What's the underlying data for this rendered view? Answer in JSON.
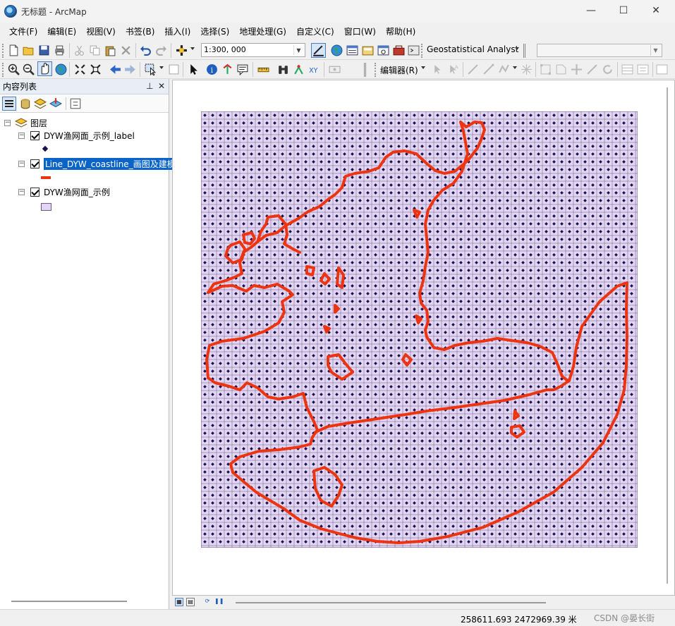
{
  "window": {
    "title": "无标题 - ArcMap",
    "minimize": "—",
    "maximize": "☐",
    "close": "✕"
  },
  "menu": [
    "文件(F)",
    "编辑(E)",
    "视图(V)",
    "书签(B)",
    "插入(I)",
    "选择(S)",
    "地理处理(G)",
    "自定义(C)",
    "窗口(W)",
    "帮助(H)"
  ],
  "toolbar": {
    "scale": "1:300, 000",
    "geostatistical": "Geostatistical Analyst",
    "editor": "编辑器(R)"
  },
  "toc": {
    "title": "内容列表",
    "pin": "ꟷ",
    "close": "✕",
    "root": "图层",
    "layers": [
      {
        "name": "DYW渔网面_示例_label",
        "symbol": "point",
        "checked": true
      },
      {
        "name": "Line_DYW_coastline_画图及建模",
        "symbol": "line",
        "checked": true,
        "selected": true
      },
      {
        "name": "DYW渔网面_示例",
        "symbol": "polygon",
        "checked": true
      }
    ]
  },
  "map": {
    "grid_fill": "#e2d6f2",
    "grid_line": "#6a5a86",
    "dot_color": "#1a1050",
    "coast_color": "#ee3311"
  },
  "status": {
    "coords": "258611.693  2472969.39 米",
    "watermark": "CSDN @晏长街"
  }
}
